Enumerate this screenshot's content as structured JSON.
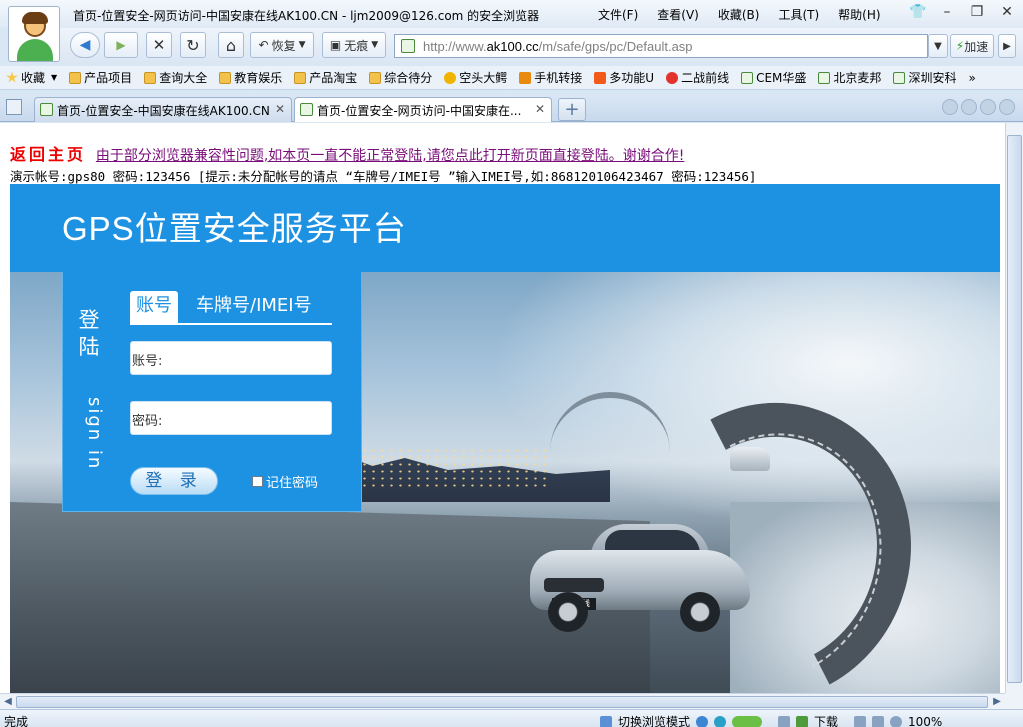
{
  "window": {
    "title": "首页-位置安全-网页访问-中国安康在线AK100.CN - ljm2009@126.com 的安全浏览器",
    "menus": [
      "文件(F)",
      "查看(V)",
      "收藏(B)",
      "工具(T)",
      "帮助(H)"
    ],
    "min": "–",
    "max": "❐",
    "close": "✕",
    "skin": "👕"
  },
  "nav": {
    "back": "◀",
    "forward": "▶",
    "stop": "✕",
    "refresh": "↻",
    "home": "⌂",
    "restore_label": "恢复",
    "notrace_label": "无痕",
    "url_prefix": "http://www.",
    "url_domain": "ak100.cc",
    "url_path": "/m/safe/gps/pc/Default.asp",
    "speedup_label": "加速"
  },
  "favorites": {
    "star_label": "收藏",
    "items": [
      "产品项目",
      "查询大全",
      "教育娱乐",
      "产品淘宝",
      "综合待分",
      "空头大鳄",
      "手机转接",
      "多功能U",
      "二战前线",
      "CEM华盛",
      "北京麦邦",
      "深圳安科"
    ],
    "more": "»"
  },
  "tabs": [
    {
      "label": "首页-位置安全-中国安康在线AK100.CN",
      "close": "✕"
    },
    {
      "label": "首页-位置安全-网页访问-中国安康在...",
      "close": "✕"
    }
  ],
  "new_tab": "+",
  "page": {
    "back_home": "返回主页",
    "compat_notice": "由于部分浏览器兼容性问题,如本页一直不能正常登陆,请您点此打开新页面直接登陆。谢谢合作!",
    "demo_info": "演示帐号:gps80 密码:123456 [提示:未分配帐号的请点 “车牌号/IMEI号 ”输入IMEI号,如:868120106423467 密码:123456]",
    "platform_title": "GPS位置安全服务平台",
    "car_plate": "爱车在线"
  },
  "login": {
    "side_cn": "登陆",
    "side_en": "sign in",
    "tab_account": "账号",
    "tab_imei": "车牌号/IMEI号",
    "account_label": "账号:",
    "password_label": "密码:",
    "account_value": "",
    "password_value": "",
    "submit": "登 录",
    "remember": "记住密码"
  },
  "status": {
    "left": "完成",
    "switch_mode": "切换浏览模式",
    "download": "下载",
    "zoom": "100%"
  }
}
